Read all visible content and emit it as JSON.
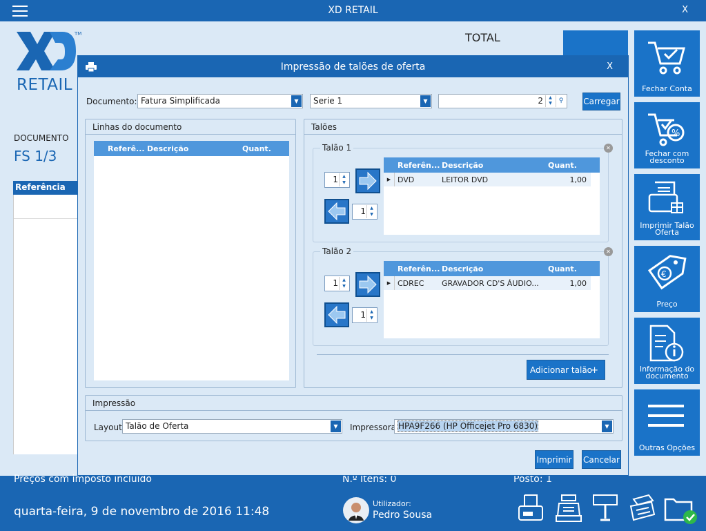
{
  "app": {
    "title": "XD RETAIL",
    "close": "X"
  },
  "logo": {
    "xd": "XD",
    "retail": "RETAIL",
    "tm": "TM"
  },
  "summary": {
    "total_label": "TOTAL",
    "documento_label": "DOCUMENTO",
    "documento_value": "FS 1/3",
    "ref_header": "Referência"
  },
  "tiles": [
    {
      "label": "Fechar Conta",
      "icon": "cart-check-icon"
    },
    {
      "label": "Fechar com desconto",
      "icon": "cart-discount-icon"
    },
    {
      "label": "Imprimir Talão Oferta",
      "icon": "gift-receipt-icon"
    },
    {
      "label": "Preço",
      "icon": "price-tag-icon"
    },
    {
      "label": "Informação do documento",
      "icon": "document-info-icon"
    },
    {
      "label": "Outras Opções",
      "icon": "menu-icon"
    }
  ],
  "dialog": {
    "title": "Impressão de talões de oferta",
    "close": "X",
    "documento_label": "Documento:",
    "documento_value": "Fatura Simplificada",
    "serie_value": "Serie 1",
    "number_value": "2",
    "carregar": "Carregar",
    "linhas": {
      "title": "Linhas do documento",
      "columns": [
        "Referê...",
        "Descrição",
        "Quant."
      ]
    },
    "taloes": {
      "title": "Talões",
      "groups": [
        {
          "legend": "Talão 1",
          "qty_in": "1",
          "qty_out": "1",
          "columns": [
            "Referên...",
            "Descrição",
            "Quant."
          ],
          "rows": [
            {
              "ref": "DVD",
              "desc": "LEITOR DVD",
              "qty": "1,00"
            }
          ]
        },
        {
          "legend": "Talão 2",
          "qty_in": "1",
          "qty_out": "1",
          "columns": [
            "Referên...",
            "Descrição",
            "Quant."
          ],
          "rows": [
            {
              "ref": "CDREC",
              "desc": "GRAVADOR CD'S ÁUDIO...",
              "qty": "1,00"
            }
          ]
        }
      ],
      "add_button": "Adicionar talão"
    },
    "impressao": {
      "title": "Impressão",
      "layout_label": "Layout:",
      "layout_value": "Talão de Oferta",
      "printer_label": "Impressora:",
      "printer_value": "HPA9F266 (HP Officejet Pro 6830)"
    },
    "imprimir": "Imprimir",
    "cancelar": "Cancelar"
  },
  "status": {
    "prices_note": "Preços com imposto incluído",
    "items": "N.º Itens: 0",
    "posto": "Posto: 1",
    "datetime": "quarta-feira, 9 de novembro de 2016 11:48",
    "user_label": "Utilizador:",
    "user_name": "Pedro Sousa"
  },
  "colors": {
    "primary": "#1a66b3",
    "tile": "#1a73c8",
    "grid_header": "#4f97dc",
    "background": "#dbe9f6"
  }
}
